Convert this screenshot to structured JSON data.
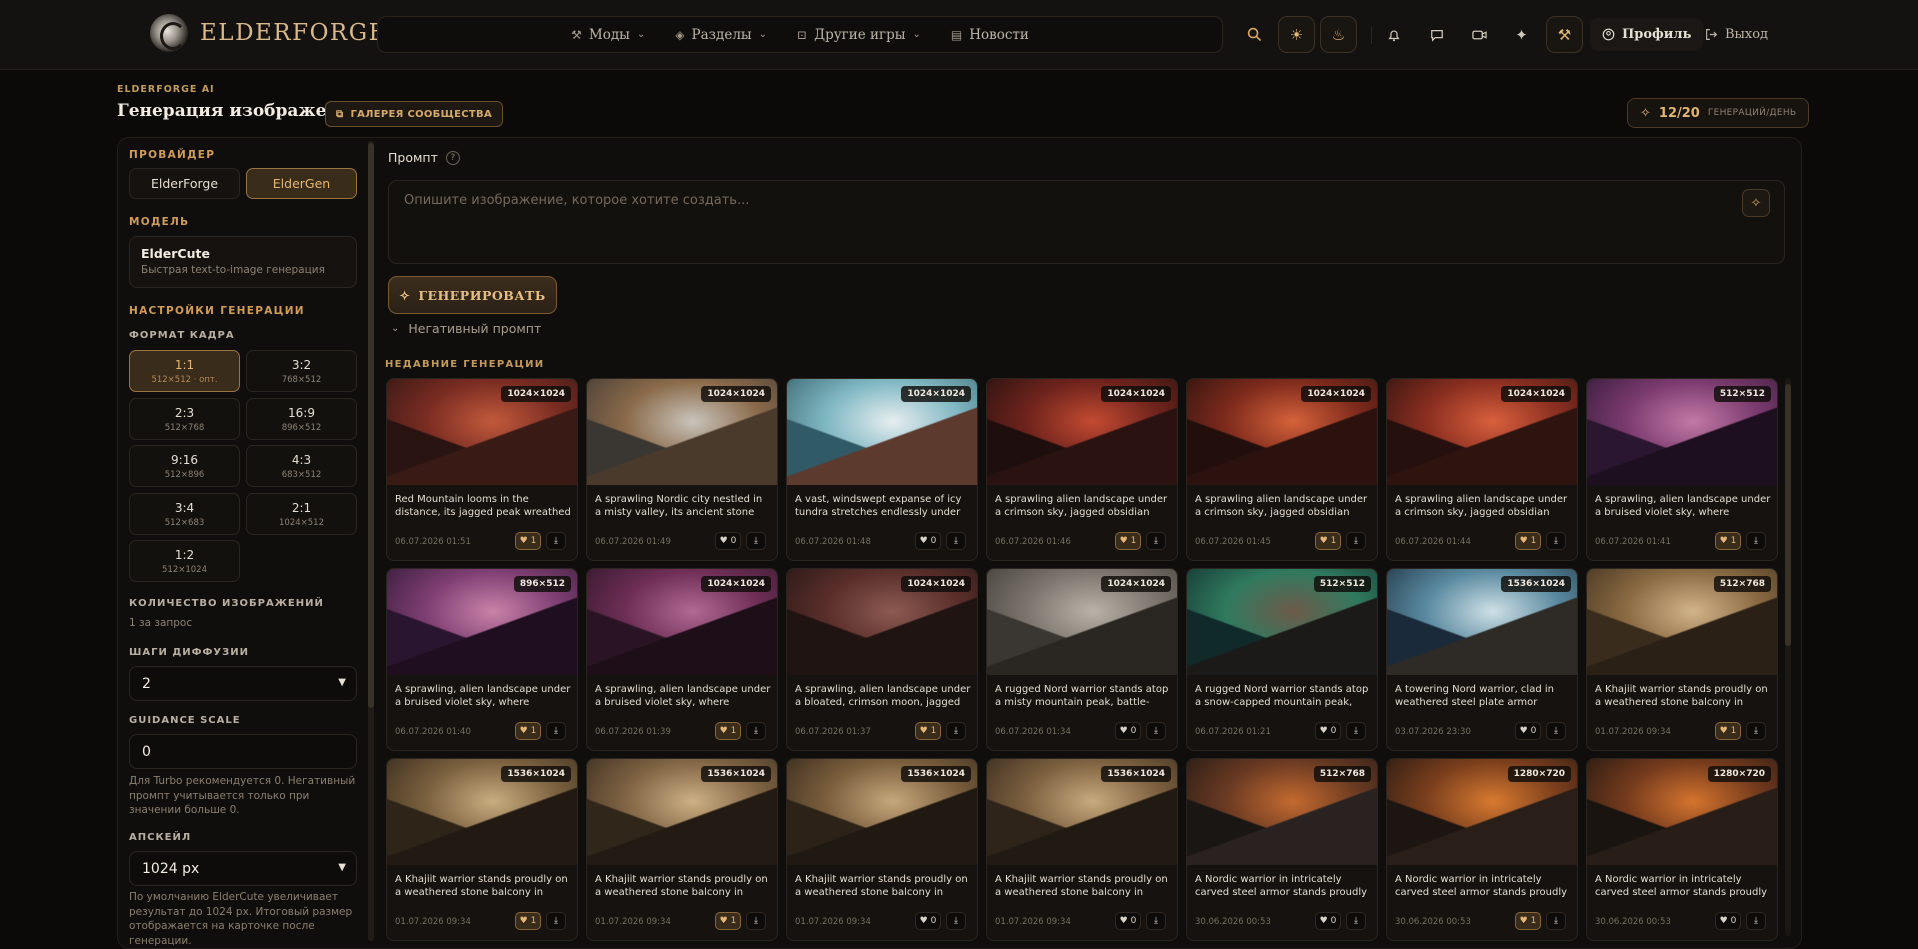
{
  "header": {
    "logo_text": "ELDERFORGE",
    "nav": [
      {
        "label": "Моды",
        "icon": "hammer-icon",
        "has_menu": true
      },
      {
        "label": "Разделы",
        "icon": "layers-icon",
        "has_menu": true
      },
      {
        "label": "Другие игры",
        "icon": "gamepad-icon",
        "has_menu": true
      },
      {
        "label": "Новости",
        "icon": "news-icon",
        "has_menu": false
      }
    ],
    "profile_label": "Профиль",
    "logout_label": "Выход"
  },
  "page": {
    "eyebrow": "ELDERFORGE AI",
    "title": "Генерация изображений",
    "gallery_button": "ГАЛЕРЕЯ СООБЩЕСТВА",
    "quota_value": "12/20",
    "quota_label": "ГЕНЕРАЦИЙ/ДЕНЬ"
  },
  "sidebar": {
    "provider_title": "ПРОВАЙДЕР",
    "providers": [
      "ElderForge",
      "ElderGen"
    ],
    "active_provider": "ElderGen",
    "model_title": "МОДЕЛЬ",
    "model_name": "ElderCute",
    "model_desc": "Быстрая text-to-image генерация",
    "settings_title": "НАСТРОЙКИ ГЕНЕРАЦИИ",
    "format_title": "ФОРМАТ КАДРА",
    "formats": [
      {
        "ratio": "1:1",
        "size": "512×512 · опт.",
        "active": true
      },
      {
        "ratio": "3:2",
        "size": "768×512",
        "active": false
      },
      {
        "ratio": "2:3",
        "size": "512×768",
        "active": false
      },
      {
        "ratio": "16:9",
        "size": "896×512",
        "active": false
      },
      {
        "ratio": "9:16",
        "size": "512×896",
        "active": false
      },
      {
        "ratio": "4:3",
        "size": "683×512",
        "active": false
      },
      {
        "ratio": "3:4",
        "size": "512×683",
        "active": false
      },
      {
        "ratio": "2:1",
        "size": "1024×512",
        "active": false
      },
      {
        "ratio": "1:2",
        "size": "512×1024",
        "active": false
      }
    ],
    "count_title": "КОЛИЧЕСТВО ИЗОБРАЖЕНИЙ",
    "count_value": "1 за запрос",
    "steps_title": "ШАГИ ДИФФУЗИИ",
    "steps_value": "2",
    "guidance_title": "GUIDANCE SCALE",
    "guidance_value": "0",
    "guidance_note": "Для Turbo рекомендуется 0. Негативный промпт учитывается только при значении больше 0.",
    "upscale_title": "АПСКЕЙЛ",
    "upscale_value": "1024 px",
    "upscale_note": "По умолчанию ElderCute увеличивает результат до 1024 px. Итоговый размер отображается на карточке после генерации."
  },
  "prompt": {
    "label": "Промпт",
    "help": "?",
    "placeholder": "Опишите изображение, которое хотите создать...",
    "generate_label": "ГЕНЕРИРОВАТЬ",
    "negative_label": "Негативный промпт"
  },
  "recent": {
    "title": "НЕДАВНИЕ ГЕНЕРАЦИИ",
    "items": [
      {
        "res": "1024×1024",
        "caption": "Red Mountain looms in the distance, its jagged peak wreathed in swirling...",
        "date": "06.07.2026 01:51",
        "likes": "1",
        "liked": true,
        "palette": [
          "#2a1412",
          "#7a2c22",
          "#c25a3c",
          "#3a1a15"
        ]
      },
      {
        "res": "1024×1024",
        "caption": "A sprawling Nordic city nestled in a misty valley, its ancient stone bridge...",
        "date": "06.07.2026 01:49",
        "likes": "0",
        "liked": false,
        "palette": [
          "#3a3632",
          "#8a6a4a",
          "#c9c4bb",
          "#4a3a2c"
        ]
      },
      {
        "res": "1024×1024",
        "caption": "A vast, windswept expanse of icy tundra stretches endlessly under a...",
        "date": "06.07.2026 01:48",
        "likes": "0",
        "liked": false,
        "palette": [
          "#2f5a66",
          "#7fb7c2",
          "#e7eef0",
          "#5c3a2e"
        ]
      },
      {
        "res": "1024×1024",
        "caption": "A sprawling alien landscape under a crimson sky, jagged obsidian cliffs...",
        "date": "06.07.2026 01:46",
        "likes": "1",
        "liked": true,
        "palette": [
          "#1e0f0e",
          "#6e231c",
          "#c34a32",
          "#2a1210"
        ]
      },
      {
        "res": "1024×1024",
        "caption": "A sprawling alien landscape under a crimson sky, jagged obsidian cliffs...",
        "date": "06.07.2026 01:45",
        "likes": "1",
        "liked": true,
        "palette": [
          "#220f0c",
          "#7e2a1c",
          "#d4623a",
          "#2b120e"
        ]
      },
      {
        "res": "1024×1024",
        "caption": "A sprawling alien landscape under a crimson sky, jagged obsidian cliffs...",
        "date": "06.07.2026 01:44",
        "likes": "1",
        "liked": true,
        "palette": [
          "#26100d",
          "#8a2e20",
          "#d8603c",
          "#2e140f"
        ]
      },
      {
        "res": "512×512",
        "caption": "A sprawling, alien landscape under a bruised violet sky, where jagged...",
        "date": "06.07.2026 01:41",
        "likes": "1",
        "liked": true,
        "palette": [
          "#2a1630",
          "#7a3a6e",
          "#c27aa6",
          "#1e0f20"
        ]
      },
      {
        "res": "896×512",
        "caption": "A sprawling, alien landscape under a bruised violet sky, where jagged...",
        "date": "06.07.2026 01:40",
        "likes": "1",
        "liked": true,
        "palette": [
          "#2a1530",
          "#7e3e72",
          "#c883a8",
          "#1e0e1f"
        ]
      },
      {
        "res": "1024×1024",
        "caption": "A sprawling, alien landscape under a bruised violet sky, where jagged...",
        "date": "06.07.2026 01:39",
        "likes": "1",
        "liked": true,
        "palette": [
          "#2a1424",
          "#6e2e56",
          "#b06a94",
          "#1d0e18"
        ]
      },
      {
        "res": "1024×1024",
        "caption": "A sprawling, alien landscape under a bloated, crimson moon, jagged cliffs...",
        "date": "06.07.2026 01:37",
        "likes": "1",
        "liked": true,
        "palette": [
          "#201413",
          "#5a2e2a",
          "#8c5a52",
          "#1f1412"
        ]
      },
      {
        "res": "1024×1024",
        "caption": "A rugged Nord warrior stands atop a misty mountain peak, battle-axe...",
        "date": "06.07.2026 01:34",
        "likes": "0",
        "liked": false,
        "palette": [
          "#3a3632",
          "#7a746c",
          "#b8b2a8",
          "#2a2622"
        ]
      },
      {
        "res": "512×512",
        "caption": "A rugged Nord warrior stands atop a snow-capped mountain peak, battle...",
        "date": "06.07.2026 01:21",
        "likes": "0",
        "liked": false,
        "palette": [
          "#102a2a",
          "#2f7a5e",
          "#6e5a4a",
          "#1c1a18"
        ]
      },
      {
        "res": "1536×1024",
        "caption": "A towering Nord warrior, clad in weathered steel plate armor adorne...",
        "date": "03.07.2026 23:30",
        "likes": "0",
        "liked": false,
        "palette": [
          "#1a2a3a",
          "#5a8aa0",
          "#cfe0e6",
          "#2e2a26"
        ]
      },
      {
        "res": "512×768",
        "caption": "A Khajiit warrior stands proudly on a weathered stone balcony in Riften,...",
        "date": "01.07.2026 09:34",
        "likes": "1",
        "liked": true,
        "palette": [
          "#3a2c1c",
          "#8a6a42",
          "#d2b48a",
          "#2a2016"
        ]
      },
      {
        "res": "1536×1024",
        "caption": "A Khajiit warrior stands proudly on a weathered stone balcony in Riften,...",
        "date": "01.07.2026 09:34",
        "likes": "1",
        "liked": true,
        "palette": [
          "#2e2418",
          "#7a603e",
          "#c9ad80",
          "#221a12"
        ]
      },
      {
        "res": "1536×1024",
        "caption": "A Khajiit warrior stands proudly on a weathered stone balcony in Riften,...",
        "date": "01.07.2026 09:34",
        "likes": "1",
        "liked": true,
        "palette": [
          "#30261a",
          "#806444",
          "#cdb084",
          "#231b13"
        ]
      },
      {
        "res": "1536×1024",
        "caption": "A Khajiit warrior stands proudly on a weathered stone balcony in Riften,...",
        "date": "01.07.2026 09:34",
        "likes": "0",
        "liked": false,
        "palette": [
          "#2c2218",
          "#7a5e3c",
          "#c6a87c",
          "#201912"
        ]
      },
      {
        "res": "1536×1024",
        "caption": "A Khajiit warrior stands proudly on a weathered stone balcony in Riften,...",
        "date": "01.07.2026 09:34",
        "likes": "0",
        "liked": false,
        "palette": [
          "#2e2419",
          "#7c603f",
          "#c8aa7e",
          "#211a13"
        ]
      },
      {
        "res": "512×768",
        "caption": "A Nordic warrior in intricately carved steel armor stands proudly in a...",
        "date": "30.06.2026 00:53",
        "likes": "0",
        "liked": false,
        "palette": [
          "#1a1614",
          "#6a3a22",
          "#c46a30",
          "#2a2220"
        ]
      },
      {
        "res": "1280×720",
        "caption": "A Nordic warrior in intricately carved steel armor stands proudly in a...",
        "date": "30.06.2026 00:53",
        "likes": "1",
        "liked": true,
        "palette": [
          "#1c1512",
          "#7a3e1c",
          "#d87a30",
          "#2a1e18"
        ]
      },
      {
        "res": "1280×720",
        "caption": "A Nordic warrior in intricately carved steel armor stands proudly in a...",
        "date": "30.06.2026 00:53",
        "likes": "0",
        "liked": false,
        "palette": [
          "#1a1411",
          "#743a1c",
          "#d4742e",
          "#281d17"
        ]
      }
    ]
  }
}
